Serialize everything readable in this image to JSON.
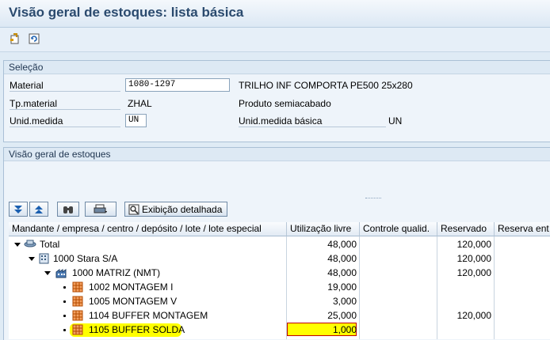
{
  "window": {
    "title": "Visão geral de estoques: lista básica"
  },
  "toolbar": {
    "icons": [
      "new-document-icon",
      "refresh-icon"
    ]
  },
  "selection": {
    "title": "Seleção",
    "material_label": "Material",
    "material_value": "1080-1297",
    "material_desc": "TRILHO INF COMPORTA PE500 25x280",
    "type_label": "Tp.material",
    "type_value": "ZHAL",
    "type_desc": "Produto semiacabado",
    "unit_label": "Unid.medida",
    "unit_value": "UN",
    "base_unit_label": "Unid.medida básica",
    "base_unit_value": "UN"
  },
  "overview": {
    "title": "Visão geral de estoques",
    "detail_button": "Exibição detalhada"
  },
  "table": {
    "headers": [
      "Mandante / empresa / centro / depósito / lote / lote especial",
      "Utilização livre",
      "Controle qualid.",
      "Reservado",
      "Reserva ent"
    ],
    "rows": [
      {
        "name": "Total",
        "free": "48,000",
        "reserved": "120,000"
      },
      {
        "name": "1000 Stara S/A",
        "free": "48,000",
        "reserved": "120,000"
      },
      {
        "name": "1000 MATRIZ (NMT)",
        "free": "48,000",
        "reserved": "120,000"
      },
      {
        "name": "1002 MONTAGEM I",
        "free": "19,000",
        "reserved": ""
      },
      {
        "name": "1005 MONTAGEM V",
        "free": "3,000",
        "reserved": ""
      },
      {
        "name": "1104 BUFFER MONTAGEM",
        "free": "25,000",
        "reserved": "120,000"
      },
      {
        "name": "1105 BUFFER SOLDA",
        "free": "1,000",
        "reserved": ""
      }
    ]
  },
  "colors": {
    "highlight": "#ffff00",
    "title": "#2a4a6e",
    "selected_border": "#c00000"
  }
}
